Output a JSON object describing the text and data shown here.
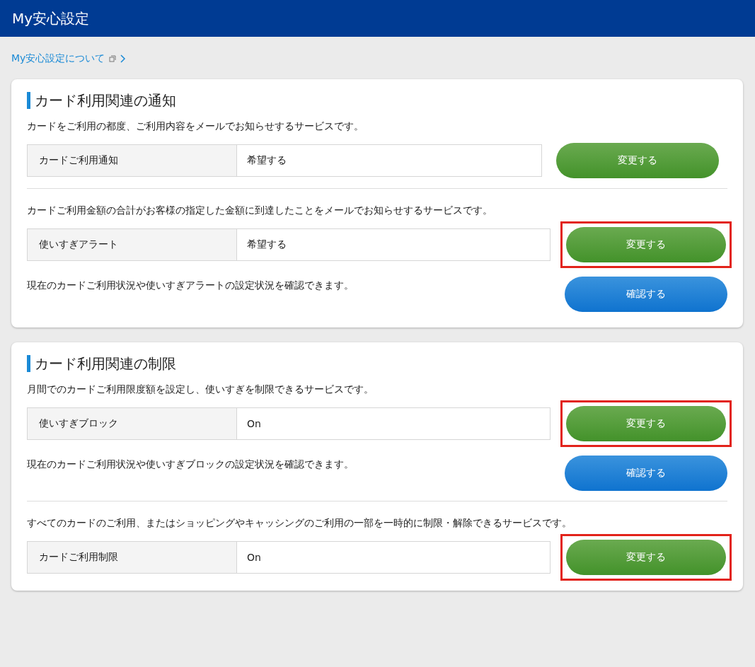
{
  "header": {
    "title": "My安心設定"
  },
  "about_link": {
    "label": "My安心設定について"
  },
  "sections": [
    {
      "title": "カード利用関連の通知",
      "blocks": [
        {
          "description": "カードをご利用の都度、ご利用内容をメールでお知らせするサービスです。",
          "setting": {
            "label": "カードご利用通知",
            "value": "希望する",
            "button": {
              "label": "変更する",
              "highlighted": false
            }
          }
        },
        {
          "description": "カードご利用金額の合計がお客様の指定した金額に到達したことをメールでお知らせするサービスです。",
          "setting": {
            "label": "使いすぎアラート",
            "value": "希望する",
            "button": {
              "label": "変更する",
              "highlighted": true
            }
          },
          "check": {
            "text": "現在のカードご利用状況や使いすぎアラートの設定状況を確認できます。",
            "button": {
              "label": "確認する"
            }
          }
        }
      ]
    },
    {
      "title": "カード利用関連の制限",
      "blocks": [
        {
          "description": "月間でのカードご利用限度額を設定し、使いすぎを制限できるサービスです。",
          "setting": {
            "label": "使いすぎブロック",
            "value": "On",
            "button": {
              "label": "変更する",
              "highlighted": true
            }
          },
          "check": {
            "text": "現在のカードご利用状況や使いすぎブロックの設定状況を確認できます。",
            "button": {
              "label": "確認する"
            }
          }
        },
        {
          "description": "すべてのカードのご利用、またはショッピングやキャッシングのご利用の一部を一時的に制限・解除できるサービスです。",
          "setting": {
            "label": "カードご利用制限",
            "value": "On",
            "button": {
              "label": "変更する",
              "highlighted": true
            }
          }
        }
      ]
    }
  ]
}
